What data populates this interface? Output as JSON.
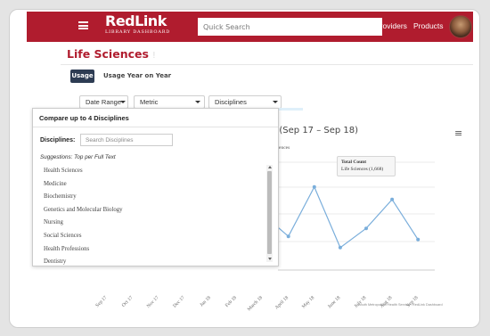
{
  "header": {
    "logo_main": "RedLink",
    "logo_sub": "Library Dashboard",
    "search_placeholder": "Quick Search",
    "nav": [
      "Providers",
      "Products"
    ],
    "colors": {
      "brand": "#b01c2e",
      "tab_active": "#2d3c53"
    }
  },
  "page": {
    "title": "Life Sciences",
    "star": "!"
  },
  "tabs": [
    {
      "label": "Usage",
      "active": true
    },
    {
      "label": "Usage Year on Year",
      "active": false
    }
  ],
  "controls": {
    "date_range": "Date Range",
    "metric": "Metric",
    "disciplines": "Disciplines"
  },
  "dropdown": {
    "heading": "Compare up to 4 Disciplines",
    "label": "Disciplines:",
    "placeholder": "Search Disciplines",
    "suggestions_label": "Suggestions: Top per Full Text",
    "items": [
      "Health Sciences",
      "Medicine",
      "Biochemistry",
      "Genetics and Molecular Biology",
      "Nursing",
      "Social Sciences",
      "Health Professions",
      "Dentistry"
    ]
  },
  "chart_data": {
    "type": "line",
    "title_visible": "s (Sep 17 – Sep 18)",
    "legend_fragment": "ences",
    "tooltip": {
      "line1": "Total Count",
      "line2": "Life Sciences (1,668)"
    },
    "categories": [
      "Sep 17",
      "Oct 17",
      "Nov 17",
      "Dec 17",
      "Jan 18",
      "Feb 18",
      "March 18",
      "April 18",
      "May 18",
      "June 18",
      "July 18",
      "Aug 18",
      "Sep 18"
    ],
    "visible_categories": [
      "April 18",
      "May 18",
      "June 18",
      "July 18",
      "Aug 18",
      "Sep 18"
    ],
    "visible_values": [
      1360,
      1668,
      1290,
      1410,
      1590,
      1340
    ],
    "partial_prior_value": 1500,
    "line_color": "#7aaedb",
    "grid": true,
    "credits": "South Metropolitan Health Service - RedLink Dashboard"
  }
}
